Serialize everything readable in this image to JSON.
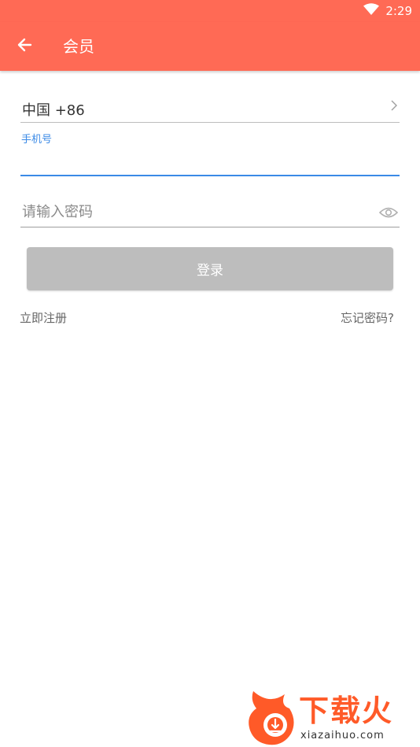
{
  "status_bar": {
    "time": "2:29",
    "wifi_icon": "wifi-icon"
  },
  "app_bar": {
    "title": "会员",
    "back_icon": "arrow-left-icon"
  },
  "country": {
    "label": "中国 +86",
    "chevron_icon": "chevron-right-icon"
  },
  "phone": {
    "label": "手机号",
    "value": ""
  },
  "password": {
    "placeholder": "请输入密码",
    "value": "",
    "eye_icon": "eye-icon"
  },
  "login_button": {
    "label": "登录"
  },
  "links": {
    "register": "立即注册",
    "forgot": "忘记密码?"
  },
  "watermark": {
    "brand": "下载火",
    "url": "xiazaihuo.com"
  },
  "colors": {
    "header": "#ff6a55",
    "accent": "#3b8ae6",
    "button_disabled": "#bdbdbd",
    "brand": "#ff5a28"
  }
}
